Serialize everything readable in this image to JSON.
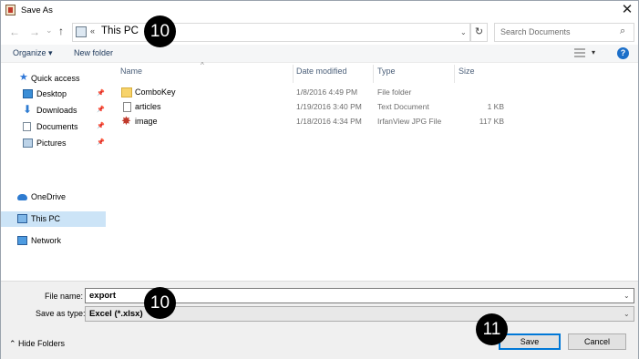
{
  "window": {
    "title": "Save As",
    "close_glyph": "✕"
  },
  "address_bar": {
    "back_glyph": "←",
    "forward_glyph": "→",
    "recent_glyph": "⌄",
    "up_glyph": "↑",
    "separator": "«",
    "location": "This PC",
    "dropdown_glyph": "⌄",
    "refresh_glyph": "↻"
  },
  "search": {
    "placeholder": "Search Documents",
    "icon": "search-icon",
    "glyph": "⌕"
  },
  "toolbar": {
    "organize": "Organize ▾",
    "new_folder": "New folder",
    "view_caret": "▾",
    "help": "?"
  },
  "nav_pane": {
    "items": [
      {
        "label": "Quick access",
        "icon": "star-icon"
      },
      {
        "label": "Desktop",
        "icon": "desktop-icon",
        "pinned": true
      },
      {
        "label": "Downloads",
        "icon": "downloads-icon",
        "pinned": true
      },
      {
        "label": "Documents",
        "icon": "documents-icon",
        "pinned": true
      },
      {
        "label": "Pictures",
        "icon": "pictures-icon",
        "pinned": true
      },
      {
        "label": "OneDrive",
        "icon": "cloud-icon"
      },
      {
        "label": "This PC",
        "icon": "computer-icon",
        "selected": true
      },
      {
        "label": "Network",
        "icon": "network-icon"
      }
    ],
    "pin_glyph": "📌",
    "star_glyph": "★",
    "download_glyph": "⬇"
  },
  "file_list": {
    "sort_glyph": "^",
    "columns": [
      "Name",
      "Date modified",
      "Type",
      "Size"
    ],
    "rows": [
      {
        "name": "ComboKey",
        "date": "1/8/2016 4:49 PM",
        "type": "File folder",
        "size": "",
        "icon": "folder-icon"
      },
      {
        "name": "articles",
        "date": "1/19/2016 3:40 PM",
        "type": "Text Document",
        "size": "1 KB",
        "icon": "text-file-icon"
      },
      {
        "name": "image",
        "date": "1/18/2016 4:34 PM",
        "type": "IrfanView JPG File",
        "size": "117 KB",
        "icon": "jpg-file-icon"
      }
    ],
    "jpg_glyph": "✸"
  },
  "save_panel": {
    "file_name_label": "File name:",
    "file_name_value": "export",
    "save_type_label": "Save as type:",
    "save_type_value": "Excel (*.xlsx)",
    "dropdown_glyph": "⌄",
    "hide_folders": "⌃ Hide Folders",
    "save_button": "Save",
    "cancel_button": "Cancel"
  },
  "annotations": {
    "badge_address": "10",
    "badge_filename": "10",
    "badge_save": "11"
  },
  "colors": {
    "accent": "#0078d7",
    "selected_bg": "#cce4f7",
    "badge": "#000000",
    "panel_bg": "#f0f0f0"
  }
}
